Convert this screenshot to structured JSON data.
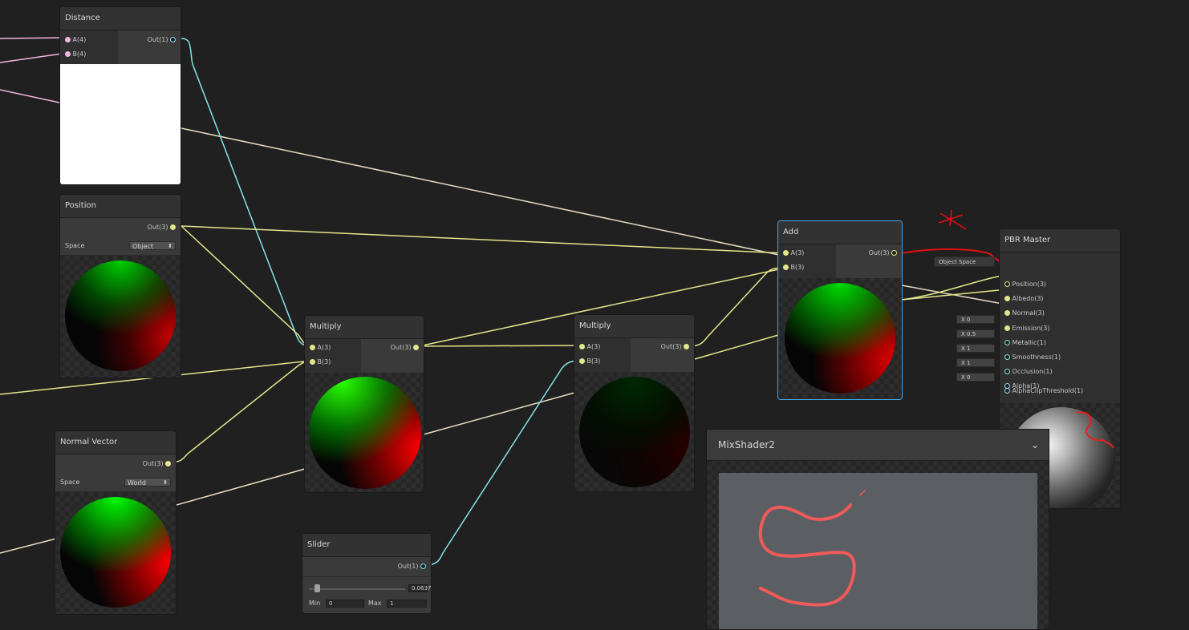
{
  "nodes": {
    "distance": {
      "title": "Distance",
      "in_a": "A(4)",
      "in_b": "B(4)",
      "out": "Out(1)"
    },
    "position": {
      "title": "Position",
      "out": "Out(3)",
      "space_label": "Space",
      "space_value": "Object"
    },
    "normal_vector": {
      "title": "Normal Vector",
      "out": "Out(3)",
      "space_label": "Space",
      "space_value": "World"
    },
    "multiply1": {
      "title": "Multiply",
      "in_a": "A(3)",
      "in_b": "B(3)",
      "out": "Out(3)"
    },
    "multiply2": {
      "title": "Multiply",
      "in_a": "A(3)",
      "in_b": "B(3)",
      "out": "Out(3)"
    },
    "add": {
      "title": "Add",
      "in_a": "A(3)",
      "in_b": "B(3)",
      "out": "Out(3)"
    },
    "slider": {
      "title": "Slider",
      "out": "Out(1)",
      "value": "0.0637",
      "min_label": "Min",
      "min_value": "0",
      "max_label": "Max",
      "max_value": "1"
    },
    "pbr_master": {
      "title": "PBR Master",
      "position_space": "Object Space",
      "ports": [
        "Position(3)",
        "Albedo(3)",
        "Normal(3)",
        "Emission(3)",
        "Metallic(1)",
        "Smoothness(1)",
        "Occlusion(1)",
        "Alpha(1)",
        "AlphaClipThreshold(1)"
      ],
      "defaults": [
        {
          "axis": "X",
          "value": "0"
        },
        {
          "axis": "X",
          "value": "0.5"
        },
        {
          "axis": "X",
          "value": "1"
        },
        {
          "axis": "X",
          "value": "1"
        },
        {
          "axis": "X",
          "value": "0"
        }
      ]
    }
  },
  "main_preview": {
    "title": "MixShader2"
  },
  "colors": {
    "background": "#202020",
    "node_body": "#393939",
    "wire_vector3": "#e4e68a",
    "wire_vector1": "#84e4e7",
    "wire_vector4": "#f2b5e0",
    "selection": "#44a8e8",
    "annotation_red": "#e01010"
  }
}
